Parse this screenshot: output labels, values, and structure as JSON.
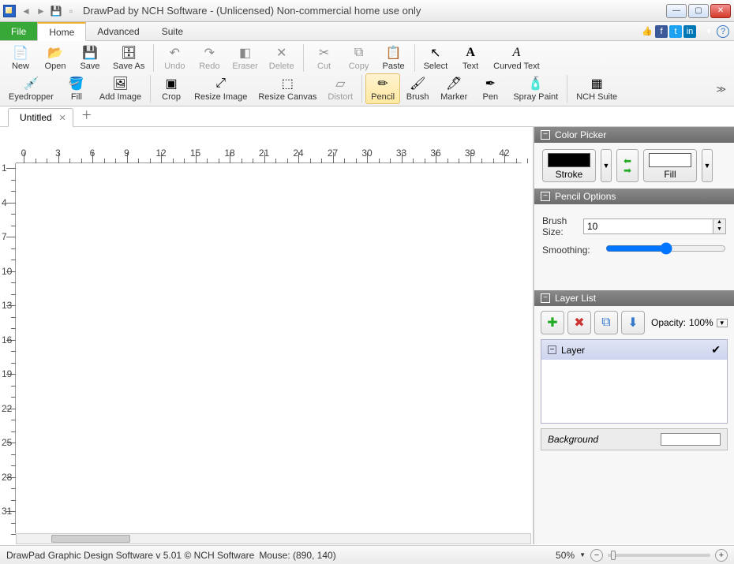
{
  "title": "DrawPad by NCH Software - (Unlicensed) Non-commercial home use only",
  "menu": {
    "file": "File",
    "home": "Home",
    "advanced": "Advanced",
    "suite": "Suite"
  },
  "ribbon1": {
    "new": "New",
    "open": "Open",
    "save": "Save",
    "saveas": "Save As",
    "undo": "Undo",
    "redo": "Redo",
    "eraser": "Eraser",
    "delete": "Delete",
    "cut": "Cut",
    "copy": "Copy",
    "paste": "Paste",
    "select": "Select",
    "text": "Text",
    "curved": "Curved Text"
  },
  "ribbon2": {
    "eyedrop": "Eyedropper",
    "fill": "Fill",
    "addimg": "Add Image",
    "crop": "Crop",
    "resizeimg": "Resize Image",
    "resizecanvas": "Resize Canvas",
    "distort": "Distort",
    "pencil": "Pencil",
    "brush": "Brush",
    "marker": "Marker",
    "pen": "Pen",
    "spray": "Spray Paint",
    "nch": "NCH Suite"
  },
  "doc": {
    "tab": "Untitled"
  },
  "panels": {
    "colorpicker": "Color Picker",
    "stroke": "Stroke",
    "fill": "Fill",
    "penciloptions": "Pencil Options",
    "brushsize": "Brush Size:",
    "brushsize_val": "10",
    "smoothing": "Smoothing:",
    "layerlist": "Layer List",
    "opacity": "Opacity:",
    "opacity_val": "100%",
    "layer": "Layer",
    "background": "Background"
  },
  "ruler_h": [
    0,
    3,
    6,
    9,
    12,
    15,
    18,
    21,
    24,
    27,
    30,
    33,
    36,
    39,
    42
  ],
  "ruler_v": [
    1,
    4,
    7,
    10,
    13,
    16,
    19,
    22,
    25,
    28,
    31
  ],
  "status": {
    "text": "DrawPad Graphic Design Software v 5.01 © NCH Software",
    "mouse": "Mouse: (890, 140)",
    "zoom": "50%"
  }
}
